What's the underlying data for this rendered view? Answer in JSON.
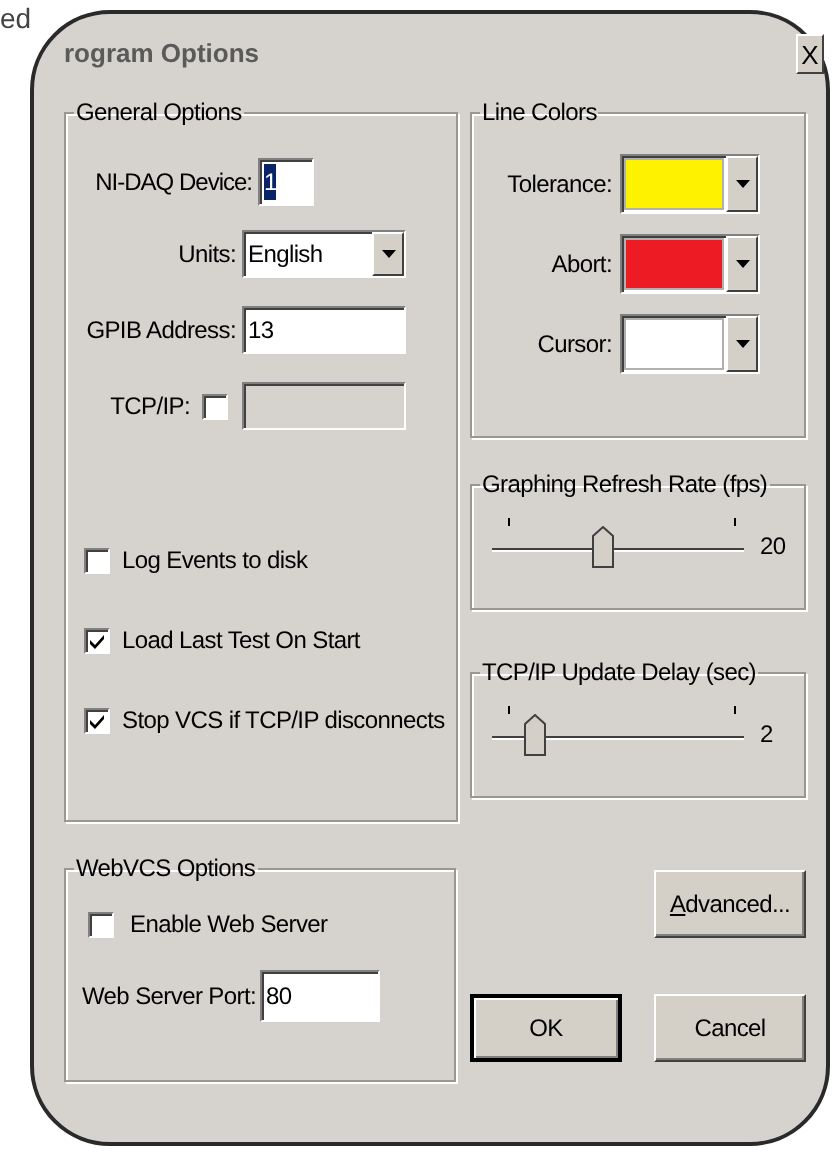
{
  "page_fragment": "ed",
  "window": {
    "title": "rogram Options",
    "close": "X"
  },
  "general_options": {
    "title": "General Options",
    "nidaq_device": {
      "label": "NI-DAQ Device:",
      "value": "1",
      "selected": true
    },
    "units": {
      "label": "Units:",
      "value": "English"
    },
    "gpib_address": {
      "label": "GPIB Address:",
      "value": "13"
    },
    "tcpip": {
      "label": "TCP/IP:",
      "checked": false,
      "disabled": true
    },
    "checkboxes": [
      {
        "label": "Log Events to disk",
        "checked": false
      },
      {
        "label": "Load Last Test On Start",
        "checked": true
      },
      {
        "label": "Stop VCS if TCP/IP disconnects",
        "checked": true
      }
    ]
  },
  "line_colors": {
    "title": "Line Colors",
    "items": [
      {
        "label": "Tolerance:",
        "color": "#fff200"
      },
      {
        "label": "Abort:",
        "color": "#ed1c24"
      },
      {
        "label": "Cursor:",
        "color": "#ffffff"
      }
    ]
  },
  "sliders": [
    {
      "title": "Graphing Refresh Rate (fps)",
      "level": 0.44,
      "reading": "20"
    },
    {
      "title": "TCP/IP Update Delay (sec)",
      "level": 0.14,
      "reading": "2"
    }
  ],
  "webvcs_options": {
    "title": "WebVCS Options",
    "enable_web_server": {
      "label": "Enable Web Server",
      "checked": false
    },
    "web_server_port": {
      "label": "Web Server Port:",
      "value": "80"
    }
  },
  "buttons": [
    {
      "label": "Advanced...",
      "default": false
    },
    {
      "label": "OK",
      "default": true
    },
    {
      "label": "Cancel",
      "default": false
    }
  ]
}
